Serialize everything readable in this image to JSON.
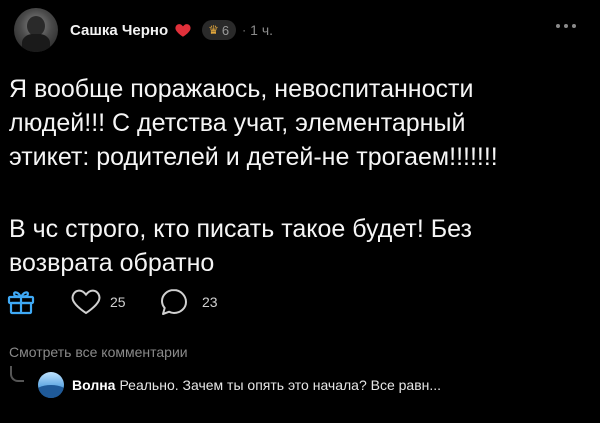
{
  "post": {
    "author": "Сашка Черно",
    "badge_count": "6",
    "separator": "·",
    "time": "1 ч.",
    "paragraphs": [
      "Я вообще поражаюсь, невоспитанности\nлюдей!!! С детства учат, элементарный\nэтикет: родителей и детей-не трогаем!!!!!!!",
      "В чс строго, кто писать такое будет! Без\nвозврата обратно"
    ]
  },
  "actions": {
    "likes": "25",
    "comments": "23"
  },
  "comments": {
    "view_all": "Смотреть все комментарии",
    "preview": {
      "author": "Волна",
      "text": "Реально. Зачем ты опять это начала? Все равн..."
    }
  },
  "colors": {
    "background": "#000000",
    "text": "#f5f5f5",
    "muted": "#8a8a8a",
    "heart": "#e0303a",
    "badge_accent": "#e2a73c"
  },
  "icons": {
    "heart": "heart-icon",
    "badge": "crown-badge-icon",
    "more": "more-dots-icon",
    "gift": "gift-icon",
    "like": "like-heart-icon",
    "comment": "comment-bubble-icon"
  }
}
